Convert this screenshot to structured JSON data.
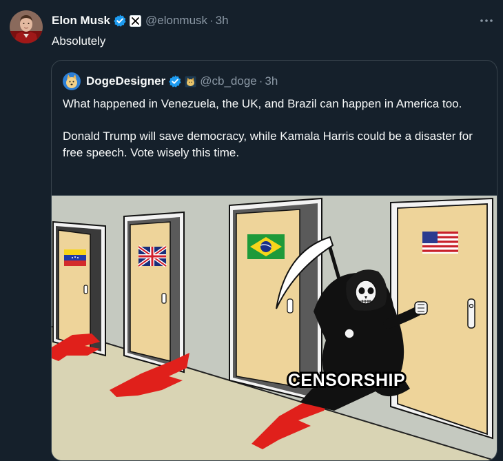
{
  "tweet": {
    "author_name": "Elon Musk",
    "author_handle": "@elonmusk",
    "separator": "·",
    "timestamp": "3h",
    "text": "Absolutely",
    "more_icon": "more-horizontal-icon",
    "affiliation_icon": "x-logo-icon"
  },
  "quote": {
    "author_name": "DogeDesigner",
    "author_handle": "@cb_doge",
    "separator": "·",
    "timestamp": "3h",
    "paragraph_1": "What happened in Venezuela, the UK, and Brazil can happen in America too.",
    "paragraph_2": "Donald Trump will save democracy, while Kamala Harris could be a disaster for free speech. Vote wisely this time.",
    "affiliation_icon": "doge-badge-icon"
  },
  "meme": {
    "label": "CENSORSHIP",
    "doors": [
      "venezuela-flag",
      "uk-flag",
      "brazil-flag",
      "usa-flag"
    ]
  },
  "colors": {
    "background": "#15202b",
    "text_primary": "#f7f9f9",
    "text_secondary": "#8b98a5",
    "border": "#38444d",
    "verified_blue": "#1d9bf0"
  }
}
